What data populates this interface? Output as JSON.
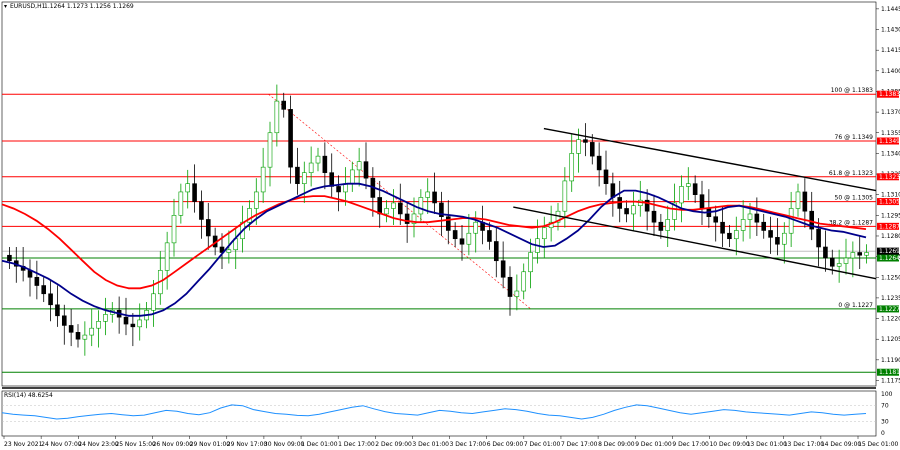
{
  "header": {
    "symbol": "EURUSD,H1",
    "ohlc": "1.1264 1.1273 1.1256 1.1269"
  },
  "rsi_header": "RSI(14) 48.6254",
  "colors": {
    "resistance": "#ff0000",
    "support": "#008000",
    "ma_fast": "#00008b",
    "ma_slow": "#ff0000",
    "trend": "#000000",
    "rsi": "#1e90ff",
    "bull": "#00a000",
    "bear": "#000000",
    "fib_label_bg": "#ff0000"
  },
  "chart_data": {
    "type": "line",
    "price_axis": {
      "ticks": [
        "1.1445",
        "1.1430",
        "1.1415",
        "1.1400",
        "1.1385",
        "1.1370",
        "1.1355",
        "1.1340",
        "1.1325",
        "1.1310",
        "1.1295",
        "1.1280",
        "1.1265",
        "1.1250",
        "1.1235",
        "1.1220",
        "1.1205",
        "1.1190",
        "1.1175"
      ],
      "range": [
        1.1171,
        1.145
      ]
    },
    "time_axis": {
      "labels": [
        "23 Nov 2021",
        "24 Nov 07:00",
        "24 Nov 23:00",
        "25 Nov 15:00",
        "26 Nov 09:00",
        "29 Nov 01:00",
        "29 Nov 17:00",
        "30 Nov 09:00",
        "1 Dec 01:00",
        "1 Dec 17:00",
        "2 Dec 09:00",
        "3 Dec 01:00",
        "3 Dec 17:00",
        "6 Dec 09:00",
        "7 Dec 01:00",
        "7 Dec 17:00",
        "8 Dec 09:00",
        "9 Dec 01:00",
        "9 Dec 17:00",
        "10 Dec 09:00",
        "13 Dec 01:00",
        "13 Dec 17:00",
        "14 Dec 09:00",
        "15 Dec 01:00"
      ]
    },
    "fib_levels": [
      {
        "label": "100 @ 1.1383",
        "value": 1.1383,
        "badge": "1.1383",
        "kind": "resistance"
      },
      {
        "label": "76 @ 1.1349",
        "value": 1.1349,
        "badge": "1.1349",
        "kind": "resistance"
      },
      {
        "label": "61.8 @ 1.1323",
        "value": 1.1323,
        "badge": "1.1323",
        "kind": "resistance"
      },
      {
        "label": "50 @ 1.1305",
        "value": 1.1305,
        "badge": "1.1305",
        "kind": "resistance"
      },
      {
        "label": "38.2 @ 1.1287",
        "value": 1.1287,
        "badge": "1.1287",
        "kind": "resistance"
      },
      {
        "label": "",
        "value": 1.1264,
        "badge": "1.1264",
        "kind": "support"
      },
      {
        "label": "0 @ 1.1227",
        "value": 1.1227,
        "badge": "1.1227",
        "kind": "support"
      },
      {
        "label": "",
        "value": 1.1181,
        "badge": "1.1181",
        "kind": "support"
      }
    ],
    "current_price": {
      "value": 1.1269,
      "badge": "1.1269"
    },
    "candles_close": [
      1.1262,
      1.1258,
      1.1255,
      1.125,
      1.1244,
      1.1238,
      1.123,
      1.1222,
      1.1215,
      1.121,
      1.1205,
      1.1208,
      1.1213,
      1.1218,
      1.1223,
      1.1226,
      1.1221,
      1.1216,
      1.1214,
      1.1219,
      1.1226,
      1.1238,
      1.1255,
      1.1275,
      1.1295,
      1.1312,
      1.1318,
      1.1305,
      1.1292,
      1.128,
      1.1272,
      1.1268,
      1.127,
      1.1278,
      1.129,
      1.13,
      1.1312,
      1.133,
      1.1355,
      1.1378,
      1.1372,
      1.133,
      1.1318,
      1.1326,
      1.1333,
      1.1338,
      1.1326,
      1.1316,
      1.1312,
      1.1318,
      1.1328,
      1.1334,
      1.1322,
      1.1308,
      1.1296,
      1.13,
      1.1304,
      1.1296,
      1.1289,
      1.1296,
      1.1308,
      1.1312,
      1.1304,
      1.1294,
      1.1284,
      1.1278,
      1.1274,
      1.1282,
      1.129,
      1.1284,
      1.1276,
      1.1262,
      1.125,
      1.1236,
      1.124,
      1.1254,
      1.1268,
      1.1278,
      1.1286,
      1.129,
      1.1298,
      1.132,
      1.134,
      1.135,
      1.1348,
      1.1338,
      1.1328,
      1.1318,
      1.1308,
      1.13,
      1.1296,
      1.1302,
      1.1306,
      1.1298,
      1.129,
      1.1284,
      1.1292,
      1.1304,
      1.1316,
      1.1318,
      1.131,
      1.13,
      1.1294,
      1.129,
      1.1282,
      1.1278,
      1.1284,
      1.1292,
      1.1296,
      1.129,
      1.1284,
      1.1279,
      1.1274,
      1.1282,
      1.13,
      1.1312,
      1.1298,
      1.1285,
      1.1272,
      1.1264,
      1.1258,
      1.126,
      1.1264,
      1.1268,
      1.1266,
      1.1268
    ],
    "ma_fast": [
      1.1262,
      1.126,
      1.1257,
      1.1253,
      1.1249,
      1.1244,
      1.1238,
      1.1233,
      1.1229,
      1.1226,
      1.1224,
      1.1222,
      1.1222,
      1.1223,
      1.1226,
      1.1231,
      1.1238,
      1.1247,
      1.1256,
      1.1266,
      1.1276,
      1.1285,
      1.1292,
      1.1298,
      1.1302,
      1.1306,
      1.131,
      1.1314,
      1.1316,
      1.1317,
      1.1318,
      1.1318,
      1.1316,
      1.1313,
      1.1309,
      1.1305,
      1.1301,
      1.1298,
      1.1296,
      1.1295,
      1.1294,
      1.1292,
      1.1289,
      1.1286,
      1.1282,
      1.1278,
      1.1274,
      1.1272,
      1.1273,
      1.1278,
      1.1284,
      1.1292,
      1.1301,
      1.1308,
      1.1313,
      1.1313,
      1.1311,
      1.1308,
      1.1304,
      1.13,
      1.1298,
      1.1297,
      1.1298,
      1.1301,
      1.1302,
      1.13,
      1.1298,
      1.1296,
      1.1294,
      1.1291,
      1.1288,
      1.1286,
      1.1284,
      1.1283,
      1.1281,
      1.1279
    ],
    "ma_slow": [
      1.1303,
      1.13,
      1.1296,
      1.1291,
      1.1285,
      1.1278,
      1.127,
      1.1262,
      1.1254,
      1.1248,
      1.1244,
      1.1242,
      1.1242,
      1.1244,
      1.1248,
      1.1254,
      1.126,
      1.1266,
      1.1272,
      1.1278,
      1.1284,
      1.129,
      1.1295,
      1.1299,
      1.1303,
      1.1306,
      1.1308,
      1.1309,
      1.1309,
      1.1307,
      1.1305,
      1.1302,
      1.1299,
      1.1296,
      1.1293,
      1.1291,
      1.129,
      1.129,
      1.1291,
      1.1292,
      1.1293,
      1.1293,
      1.1292,
      1.129,
      1.1288,
      1.1287,
      1.1286,
      1.1287,
      1.129,
      1.1294,
      1.1298,
      1.1301,
      1.1303,
      1.1304,
      1.1305,
      1.1305,
      1.1304,
      1.1302,
      1.13,
      1.1299,
      1.1299,
      1.13,
      1.1301,
      1.1302,
      1.1302,
      1.1301,
      1.1299,
      1.1297,
      1.1295,
      1.1293,
      1.1291,
      1.1289,
      1.1288,
      1.1287,
      1.1286,
      1.1285
    ],
    "trendlines": [
      {
        "from": {
          "i": 0.62,
          "v": 1.1358
        },
        "to": {
          "i": 1.0,
          "v": 1.1313
        }
      },
      {
        "from": {
          "i": 0.585,
          "v": 1.1301
        },
        "to": {
          "i": 1.0,
          "v": 1.1249
        }
      }
    ],
    "fib_diagonal": {
      "from": {
        "i": 0.305,
        "v": 1.1383
      },
      "to": {
        "i": 0.605,
        "v": 1.1227
      }
    },
    "rsi": {
      "ticks": [
        "100",
        "70",
        "30",
        "0"
      ],
      "values": [
        52,
        48,
        46,
        44,
        40,
        36,
        38,
        42,
        45,
        48,
        50,
        47,
        44,
        46,
        52,
        58,
        56,
        50,
        47,
        52,
        64,
        72,
        70,
        60,
        55,
        50,
        48,
        45,
        44,
        48,
        54,
        60,
        66,
        70,
        62,
        55,
        50,
        48,
        46,
        52,
        58,
        56,
        52,
        50,
        54,
        58,
        62,
        60,
        56,
        50,
        46,
        44,
        40,
        36,
        40,
        48,
        58,
        66,
        72,
        70,
        64,
        58,
        52,
        48,
        52,
        56,
        60,
        58,
        54,
        52,
        50,
        48,
        46,
        50,
        54,
        52,
        48,
        46,
        48,
        50
      ]
    }
  }
}
